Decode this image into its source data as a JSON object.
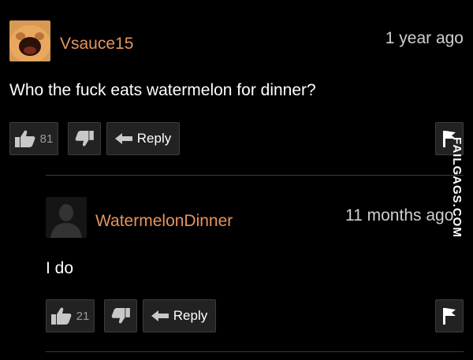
{
  "comments": [
    {
      "username": "Vsauce15",
      "timestamp": "1 year ago",
      "text": "Who the fuck eats watermelon for dinner?",
      "like_count": "81",
      "reply_label": "Reply",
      "avatar_icon": "orange-face-avatar-icon"
    },
    {
      "username": "WatermelonDinner",
      "timestamp": "11 months ago",
      "text": "I do",
      "like_count": "21",
      "reply_label": "Reply",
      "avatar_icon": "default-silhouette-avatar-icon"
    }
  ],
  "watermark": "FAILGAGS.COM",
  "colors": {
    "username": "#e5945d",
    "background": "#000000",
    "button_bg": "#222222",
    "button_border": "#3d3d3d"
  }
}
